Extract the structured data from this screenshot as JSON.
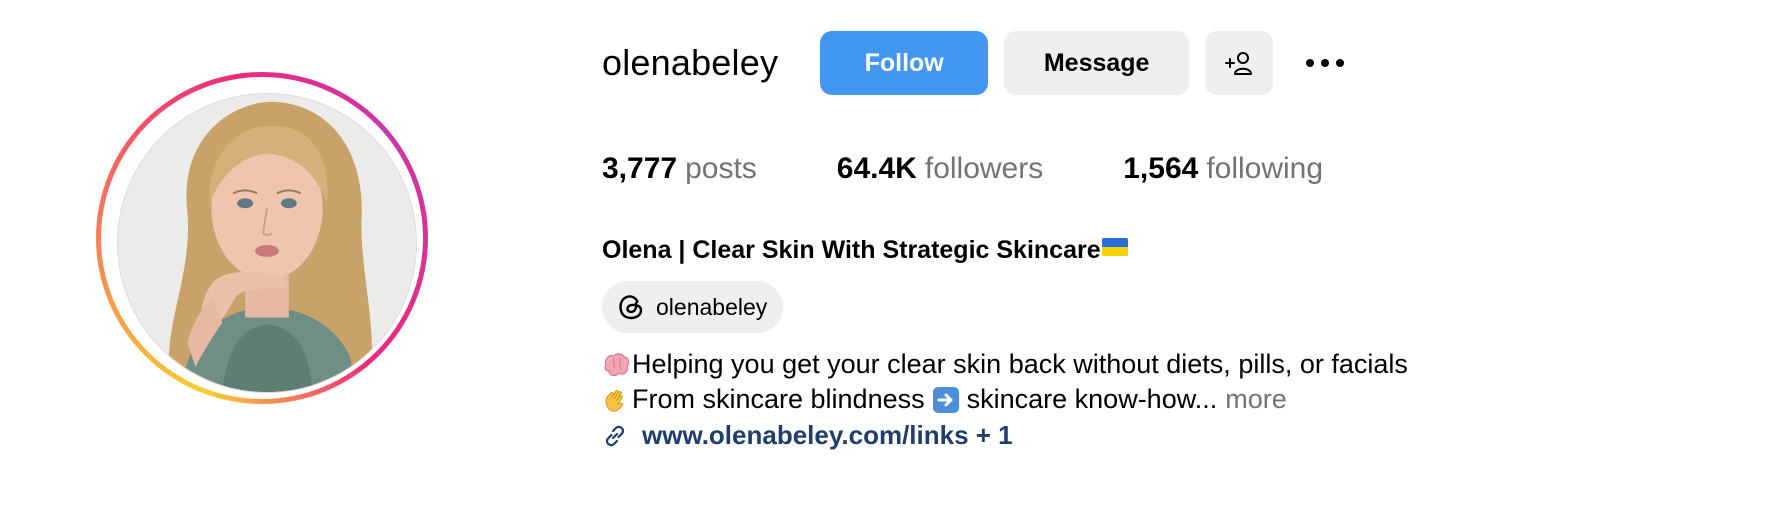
{
  "profile": {
    "username": "olenabeley",
    "full_name": "Olena | Clear Skin With Strategic Skincare",
    "threads_handle": "olenabeley",
    "avatar_alt": "profile photo"
  },
  "actions": {
    "follow_label": "Follow",
    "message_label": "Message",
    "suggest_icon": "person-plus-icon",
    "more_icon": "ellipsis-icon"
  },
  "stats": [
    {
      "value": "3,777",
      "label": "posts"
    },
    {
      "value": "64.4K",
      "label": "followers"
    },
    {
      "value": "1,564",
      "label": "following"
    }
  ],
  "bio": {
    "line1_emoji": "brain-emoji",
    "line1_text": "Helping you get your clear skin back without diets, pills, or facials",
    "line2_emoji": "waving-hand-emoji",
    "line2_text_a": "From skincare blindness",
    "line2_arrow": "right-arrow-emoji",
    "line2_text_b": "skincare know-how...",
    "more_label": "more",
    "name_flag": "ukraine-flag-emoji"
  },
  "link": {
    "text": "www.olenabeley.com/links + 1",
    "icon": "link-icon"
  },
  "colors": {
    "follow_button": "#4296f0",
    "secondary_button": "#efefef",
    "muted_text": "#737373",
    "link_text": "#1f3d6e"
  }
}
